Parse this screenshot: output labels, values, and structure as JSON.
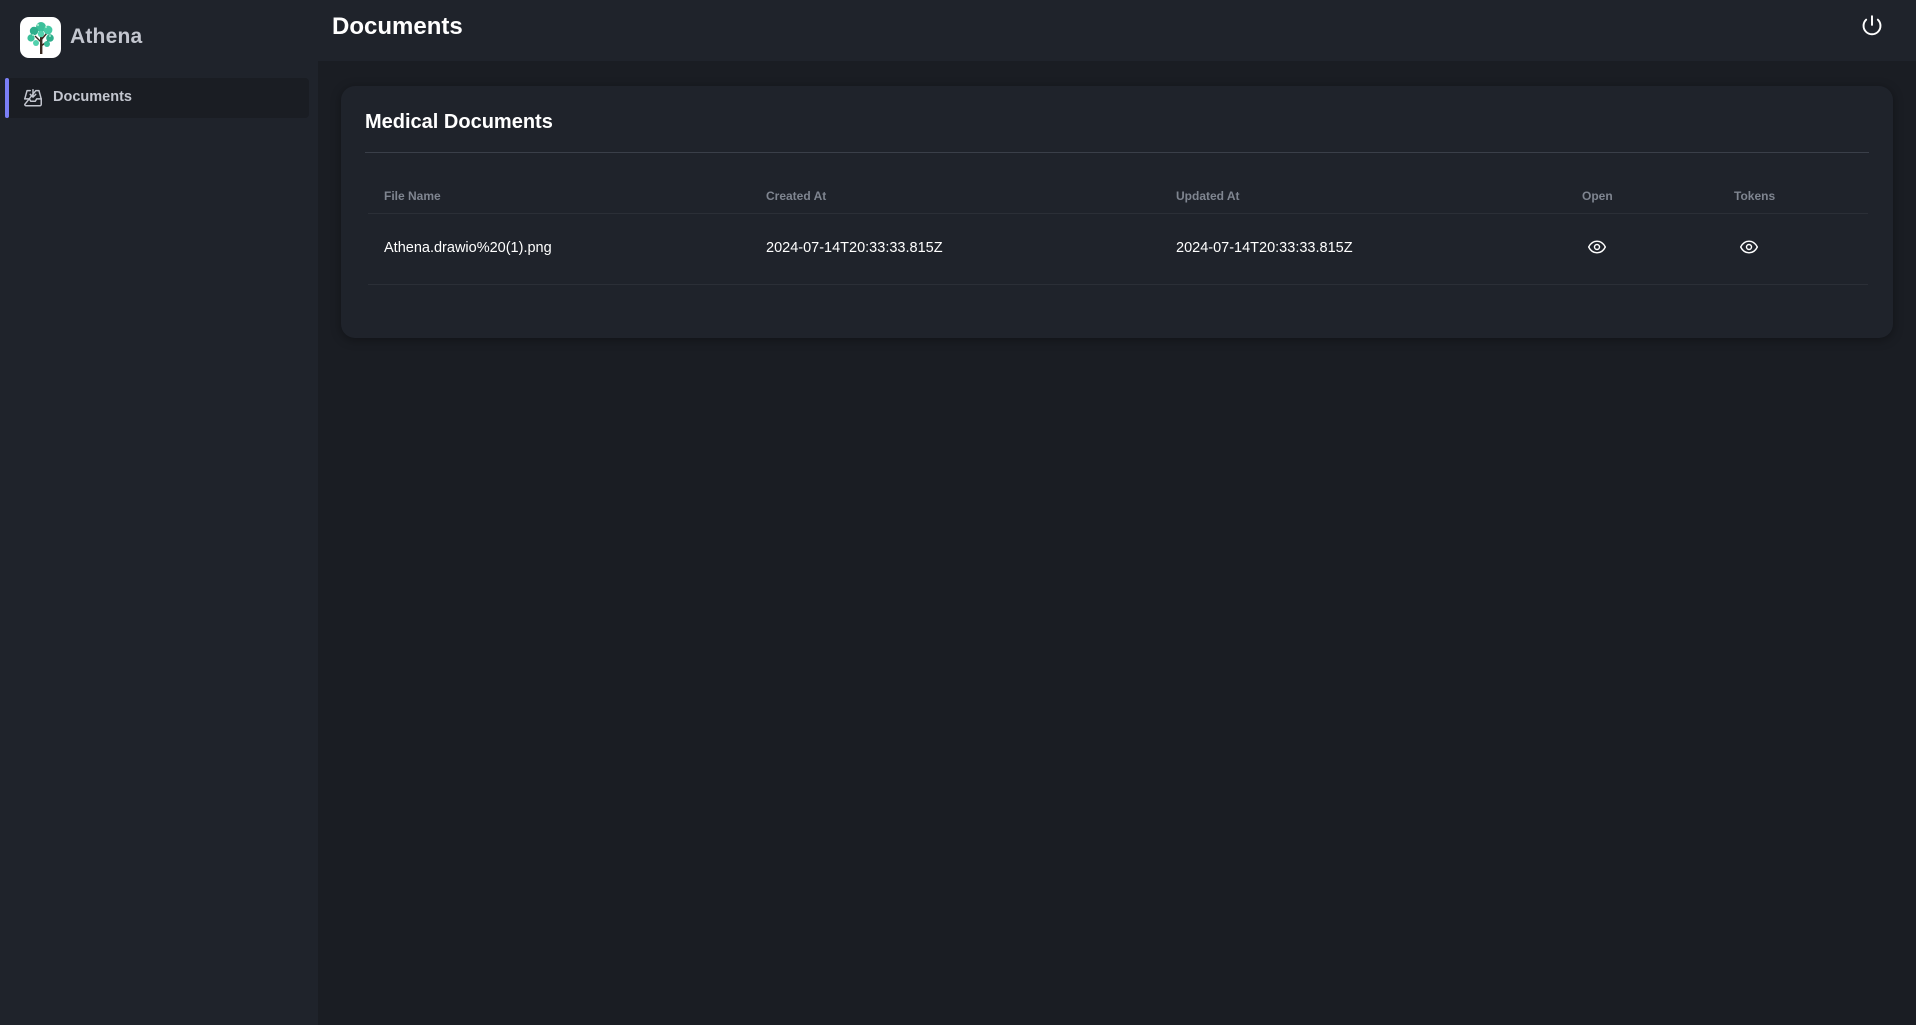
{
  "app": {
    "name": "Athena",
    "accent_color": "#7b7ff7"
  },
  "sidebar": {
    "items": [
      {
        "label": "Documents",
        "icon": "inbox-download-icon",
        "active": true
      }
    ]
  },
  "header": {
    "title": "Documents",
    "power_icon": "power-icon"
  },
  "card": {
    "title": "Medical Documents",
    "table": {
      "columns": [
        "File Name",
        "Created At",
        "Updated At",
        "Open",
        "Tokens"
      ],
      "rows": [
        {
          "file_name": "Athena.drawio%20(1).png",
          "created_at": "2024-07-14T20:33:33.815Z",
          "updated_at": "2024-07-14T20:33:33.815Z",
          "open_icon": "eye-icon",
          "tokens_icon": "eye-icon"
        }
      ]
    }
  }
}
